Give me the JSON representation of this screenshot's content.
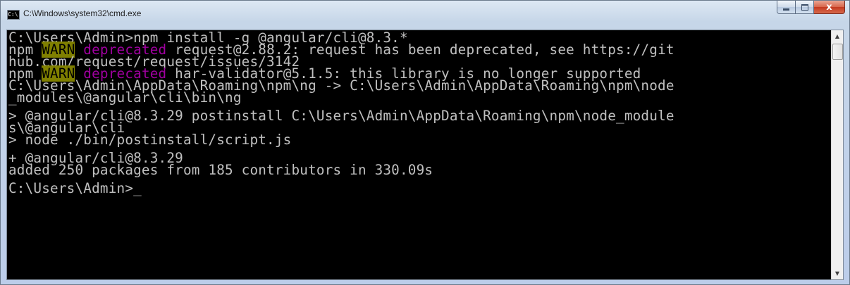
{
  "window": {
    "title": "C:\\Windows\\system32\\cmd.exe",
    "app_icon_text": "C:\\",
    "controls": {
      "minimize": "",
      "maximize": "",
      "close": "x"
    }
  },
  "console": {
    "l1": "C:\\Users\\Admin>npm install -g @angular/cli@8.3.*",
    "l2_prefix": "npm ",
    "l2_warn": "WARN",
    "l2_gap": " ",
    "l2_deprecated": "deprecated",
    "l2_text": " request@2.88.2: request has been deprecated, see https://git",
    "l3": "hub.com/request/request/issues/3142",
    "l4_prefix": "npm ",
    "l4_warn": "WARN",
    "l4_gap": " ",
    "l4_deprecated": "deprecated",
    "l4_text": " har-validator@5.1.5: this library is no longer supported",
    "l5": "C:\\Users\\Admin\\AppData\\Roaming\\npm\\ng -> C:\\Users\\Admin\\AppData\\Roaming\\npm\\node",
    "l6": "_modules\\@angular\\cli\\bin\\ng",
    "l7": "> @angular/cli@8.3.29 postinstall C:\\Users\\Admin\\AppData\\Roaming\\npm\\node_module",
    "l8": "s\\@angular\\cli",
    "l9": "> node ./bin/postinstall/script.js",
    "l10": "+ @angular/cli@8.3.29",
    "l11": "added 250 packages from 185 contributors in 330.09s",
    "l12": "C:\\Users\\Admin>",
    "cursor": "_"
  },
  "scrollbar": {
    "up_arrow": "▲",
    "down_arrow": "▼"
  },
  "colors": {
    "console_bg": "#000000",
    "console_text": "#c0c0c0",
    "warn_bg": "#808000",
    "deprecated_text": "#a000a0"
  }
}
